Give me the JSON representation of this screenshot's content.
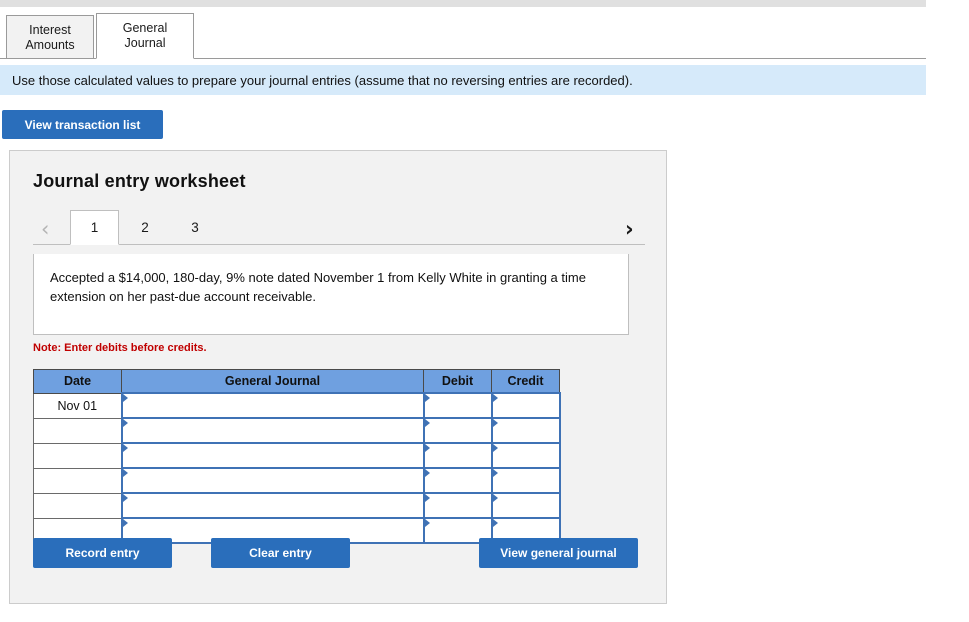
{
  "tabs": [
    {
      "id": "interest",
      "label_line1": "Interest",
      "label_line2": "Amounts",
      "active": false
    },
    {
      "id": "general",
      "label_line1": "General",
      "label_line2": "Journal",
      "active": true
    }
  ],
  "banner": {
    "text": "Use those calculated values to prepare your journal entries (assume that no reversing entries are recorded)."
  },
  "toolbar": {
    "view_transaction_list_label": "View transaction list"
  },
  "worksheet": {
    "title": "Journal entry worksheet",
    "pagination": {
      "prev_icon": "chevron-left-icon",
      "next_icon": "chevron-right-icon",
      "prev_glyph": "‹",
      "next_glyph": "›",
      "pages": [
        "1",
        "2",
        "3"
      ],
      "active_page": "1"
    },
    "description": "Accepted a $14,000, 180-day, 9% note dated November 1 from Kelly White in granting a time extension on her past-due account receivable.",
    "note": "Note: Enter debits before credits.",
    "table": {
      "headers": [
        "Date",
        "General Journal",
        "Debit",
        "Credit"
      ],
      "rows": [
        {
          "date": "Nov 01",
          "general_journal": "",
          "debit": "",
          "credit": ""
        },
        {
          "date": "",
          "general_journal": "",
          "debit": "",
          "credit": ""
        },
        {
          "date": "",
          "general_journal": "",
          "debit": "",
          "credit": ""
        },
        {
          "date": "",
          "general_journal": "",
          "debit": "",
          "credit": ""
        },
        {
          "date": "",
          "general_journal": "",
          "debit": "",
          "credit": ""
        },
        {
          "date": "",
          "general_journal": "",
          "debit": "",
          "credit": ""
        }
      ]
    },
    "actions": {
      "record_entry_label": "Record entry",
      "clear_entry_label": "Clear entry",
      "view_general_journal_label": "View general journal"
    }
  },
  "colors": {
    "primary_button": "#2a6ebb",
    "banner_background": "#d6eafa",
    "table_header": "#6fa0e0",
    "input_border": "#3f72b5",
    "note_text": "#c00000",
    "panel_background": "#f2f2f2"
  }
}
